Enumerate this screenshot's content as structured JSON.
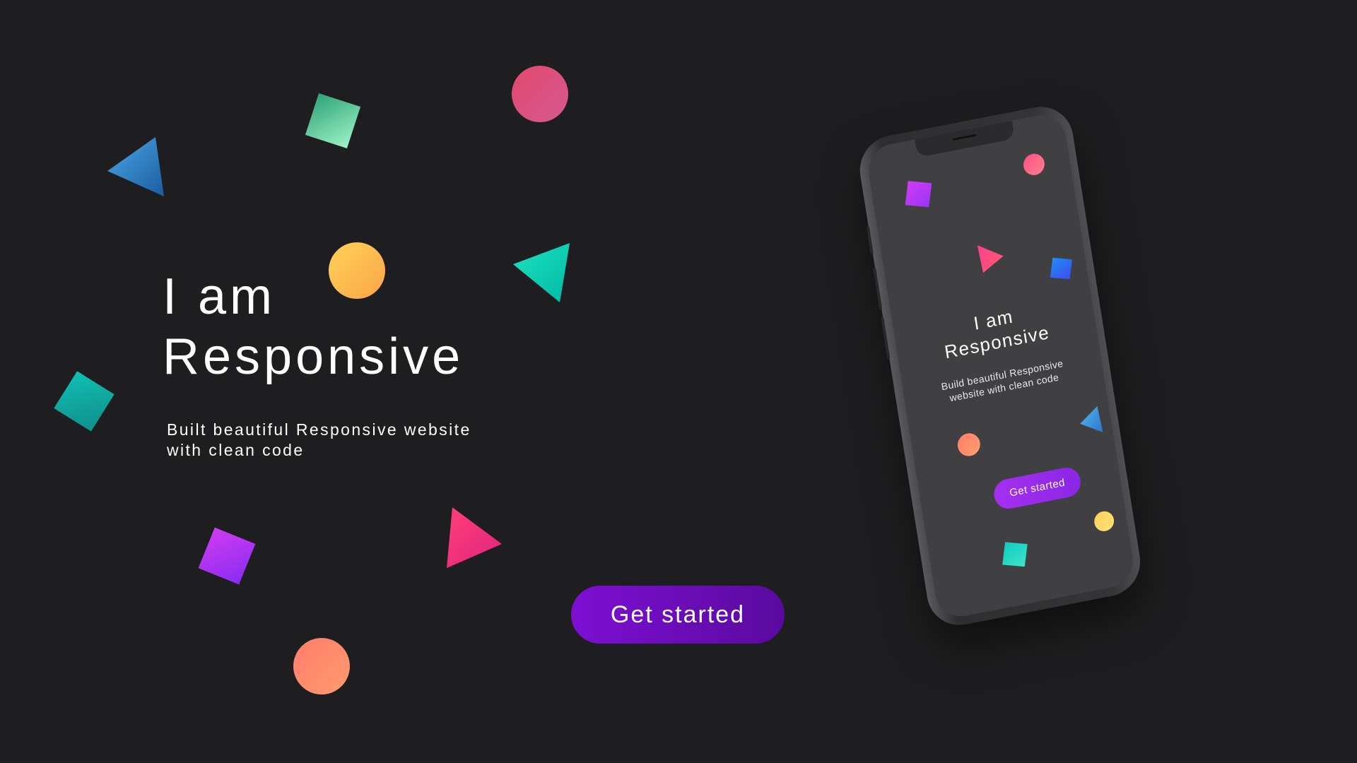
{
  "hero": {
    "title_line1": "I am",
    "title_line2": "Responsive",
    "subtitle_line1": "Built beautiful Responsive website",
    "subtitle_line2": "with clean code",
    "cta_label": "Get started"
  },
  "phone": {
    "title_line1": "I am",
    "title_line2": "Responsive",
    "subtitle": "Build beautiful Responsive website with clean code",
    "cta_label": "Get started"
  },
  "colors": {
    "background": "#1e1e20",
    "cta_start": "#7d0fd3",
    "cta_end": "#5a0a9e",
    "phone_screen": "#404042",
    "phone_cta": "#a52ff0"
  },
  "decorations": {
    "left_shapes": [
      "blue-triangle-icon",
      "green-square-icon",
      "pink-circle-icon",
      "yellow-circle-icon",
      "teal-triangle-icon",
      "teal-square-icon",
      "purple-square-icon",
      "pink-triangle-icon",
      "orange-circle-icon"
    ],
    "phone_shapes": [
      "purple-square-icon",
      "pink-circle-icon",
      "pink-triangle-icon",
      "blue-square-icon",
      "orange-circle-icon",
      "blue-triangle-icon",
      "yellow-circle-icon",
      "teal-square-icon"
    ]
  }
}
